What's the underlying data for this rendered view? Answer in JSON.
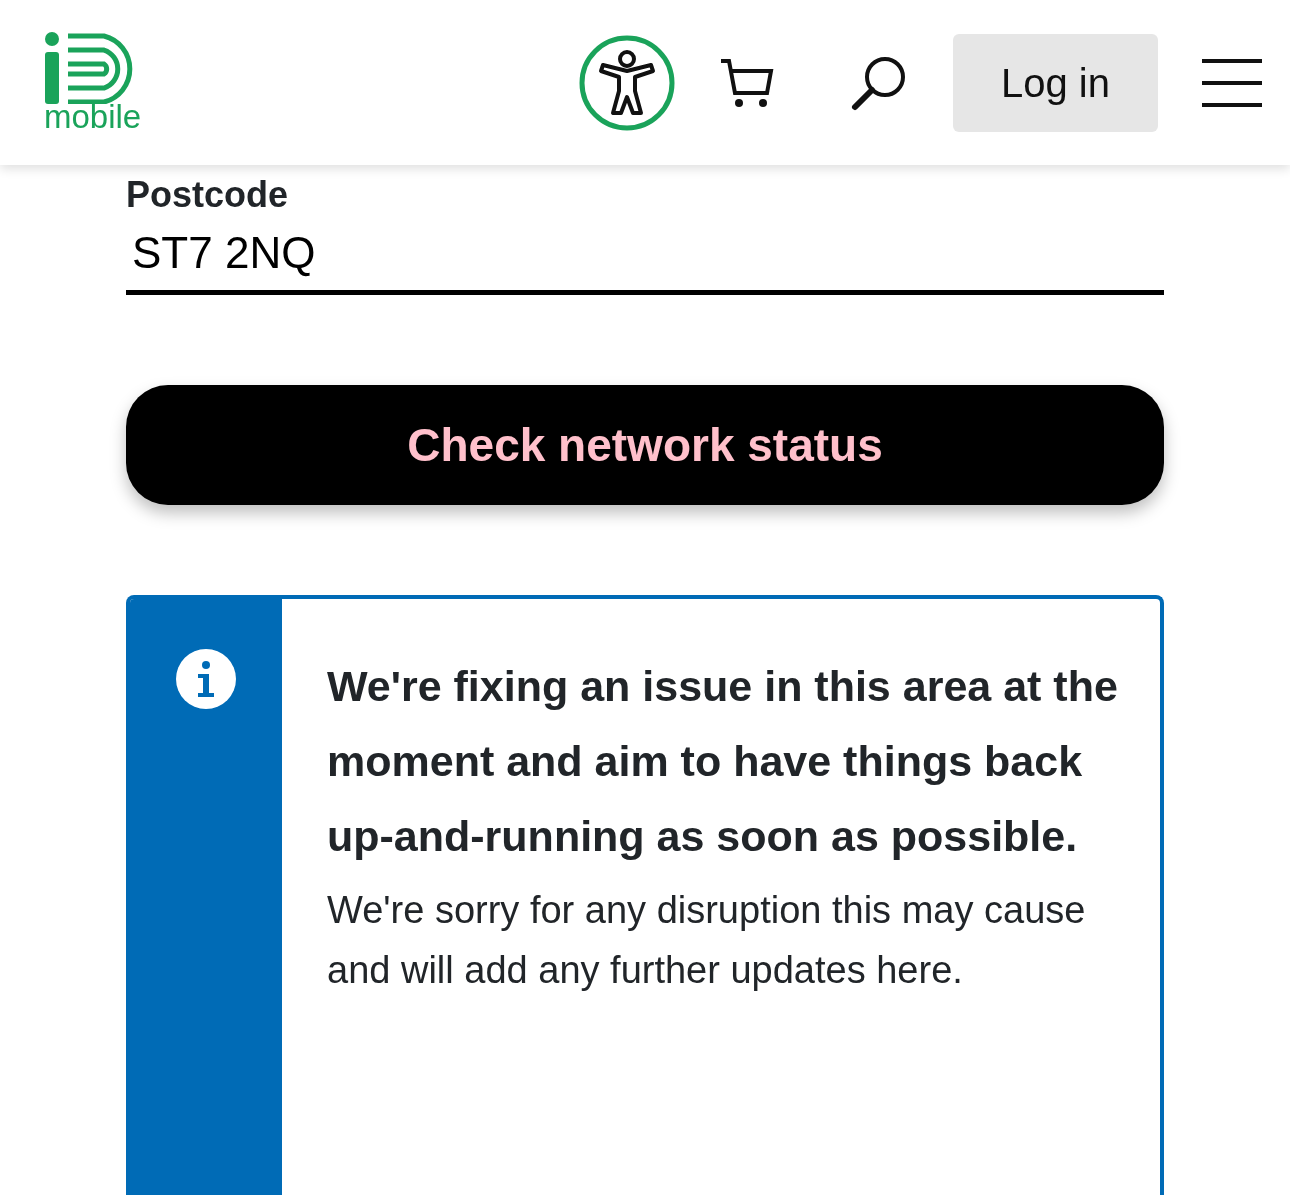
{
  "header": {
    "logo_text": "mobile",
    "login_label": "Log in"
  },
  "postcode": {
    "label": "Postcode",
    "value": "ST7 2NQ"
  },
  "check_button": {
    "label": "Check network status"
  },
  "alert": {
    "kind": "info",
    "heading": "We're fixing an issue in this area at the moment and aim to have things back up-and-running as soon as possible.",
    "body": "We're sorry for any disruption this may cause and will add any further updates here."
  }
}
